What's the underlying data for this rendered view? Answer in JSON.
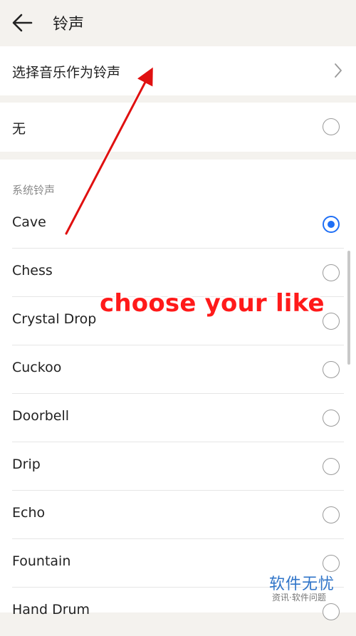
{
  "header": {
    "title": "铃声",
    "back_icon": "back-arrow-icon"
  },
  "music_option": {
    "label": "选择音乐作为铃声",
    "icon": "chevron-right-icon"
  },
  "none_option": {
    "label": "无",
    "selected": false
  },
  "system_section": {
    "label": "系统铃声",
    "items": [
      {
        "label": "Cave",
        "selected": true
      },
      {
        "label": "Chess",
        "selected": false
      },
      {
        "label": "Crystal Drop",
        "selected": false
      },
      {
        "label": "Cuckoo",
        "selected": false
      },
      {
        "label": "Doorbell",
        "selected": false
      },
      {
        "label": "Drip",
        "selected": false
      },
      {
        "label": "Echo",
        "selected": false
      },
      {
        "label": "Fountain",
        "selected": false
      },
      {
        "label": "Hand Drum",
        "selected": false
      }
    ]
  },
  "annotation": {
    "text": "choose your like",
    "color": "#ff1a1a"
  },
  "watermark": {
    "title": "软件无忧",
    "subtitle": "资讯·软件问题"
  },
  "colors": {
    "accent": "#1f6ff5",
    "background": "#f4f2ee"
  }
}
